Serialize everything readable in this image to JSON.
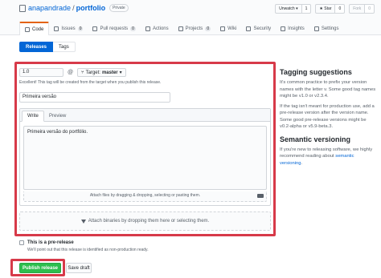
{
  "repo": {
    "owner": "anapandrade",
    "name": "portfolio",
    "visibility": "Private"
  },
  "actions": [
    {
      "label": "Unwatch ▾",
      "count": "1"
    },
    {
      "label": "★ Star",
      "count": "0"
    },
    {
      "label": "Fork",
      "count": "0"
    }
  ],
  "tabs": [
    {
      "label": "Code"
    },
    {
      "label": "Issues",
      "count": "0"
    },
    {
      "label": "Pull requests",
      "count": "0"
    },
    {
      "label": "Actions"
    },
    {
      "label": "Projects",
      "count": "0"
    },
    {
      "label": "Wiki"
    },
    {
      "label": "Security"
    },
    {
      "label": "Insights"
    },
    {
      "label": "Settings"
    }
  ],
  "subnav": {
    "releases": "Releases",
    "tags": "Tags"
  },
  "form": {
    "tag_value": "1.0",
    "target_label": "Target:",
    "target_value": "master",
    "tag_hint": "Excellent! This tag will be created from the target when you publish this release.",
    "title_value": "Primeira versão",
    "write_tab": "Write",
    "preview_tab": "Preview",
    "description": "Primeira versão do portfólio.",
    "attach_hint": "Attach files by dragging & dropping, selecting or pasting them.",
    "binaries_hint": "Attach binaries by dropping them here or selecting them.",
    "prerelease_label": "This is a pre-release",
    "prerelease_note": "We'll point out that this release is identified as non-production ready.",
    "publish_label": "Publish release",
    "draft_label": "Save draft"
  },
  "sidebar": {
    "tagging_title": "Tagging suggestions",
    "tagging_p1": "It's common practice to prefix your version names with the letter v. Some good tag names might be v1.0 or v2.3.4.",
    "tagging_p2": "If the tag isn't meant for production use, add a pre-release version after the version name. Some good pre-release versions might be v0.2-alpha or v5.9-beta.3.",
    "semver_title": "Semantic versioning",
    "semver_p_prefix": "If you're new to releasing software, we highly recommend reading about ",
    "semver_link": "semantic versioning",
    "semver_p_suffix": "."
  },
  "colors": {
    "highlight": "#d73a49",
    "publish": "#2cbe4e",
    "link": "#0366d6",
    "active_tab": "#e36209"
  }
}
